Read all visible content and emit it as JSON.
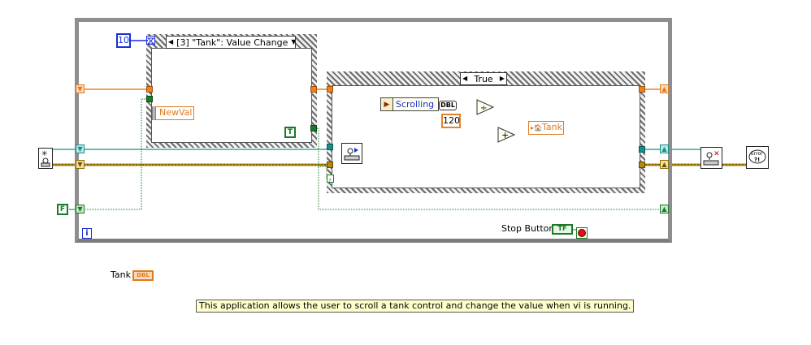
{
  "event_structure": {
    "case_label": "[3] \"Tank\": Value Change",
    "event_data": "NewVal"
  },
  "case_structure": {
    "case_label": "True"
  },
  "timeout_constant": "10",
  "numeric_constant": "120",
  "property_node": {
    "property": "Scrolling",
    "type": "DBL"
  },
  "local_variable": "Tank",
  "bool_true_constant": "T",
  "bool_false_constant": "F",
  "iteration_terminal": "i",
  "stop_button": {
    "label": "Stop Button",
    "terminal": "TF"
  },
  "tank_control": {
    "label": "Tank",
    "type": "DBL"
  },
  "comment": "This application allows the user to scroll a tank control and change the value when vi is running.",
  "operators": {
    "divide": "÷",
    "add": "+"
  },
  "error_handler_label": "Error ?!",
  "colors": {
    "numeric_wire": "#f08020",
    "refnum_wire": "#138f8a",
    "error_wire": "#b58a10",
    "boolean_wire": "#1a7a2a",
    "reference_wire": "#8a3a16",
    "constant_blue": "#1a2fd6"
  },
  "icons": {
    "open_reference": "open-reference-icon",
    "invoke_node": "scroll-invoke-icon",
    "close_reference": "close-reference-icon",
    "error_handler": "error-handler-icon"
  }
}
